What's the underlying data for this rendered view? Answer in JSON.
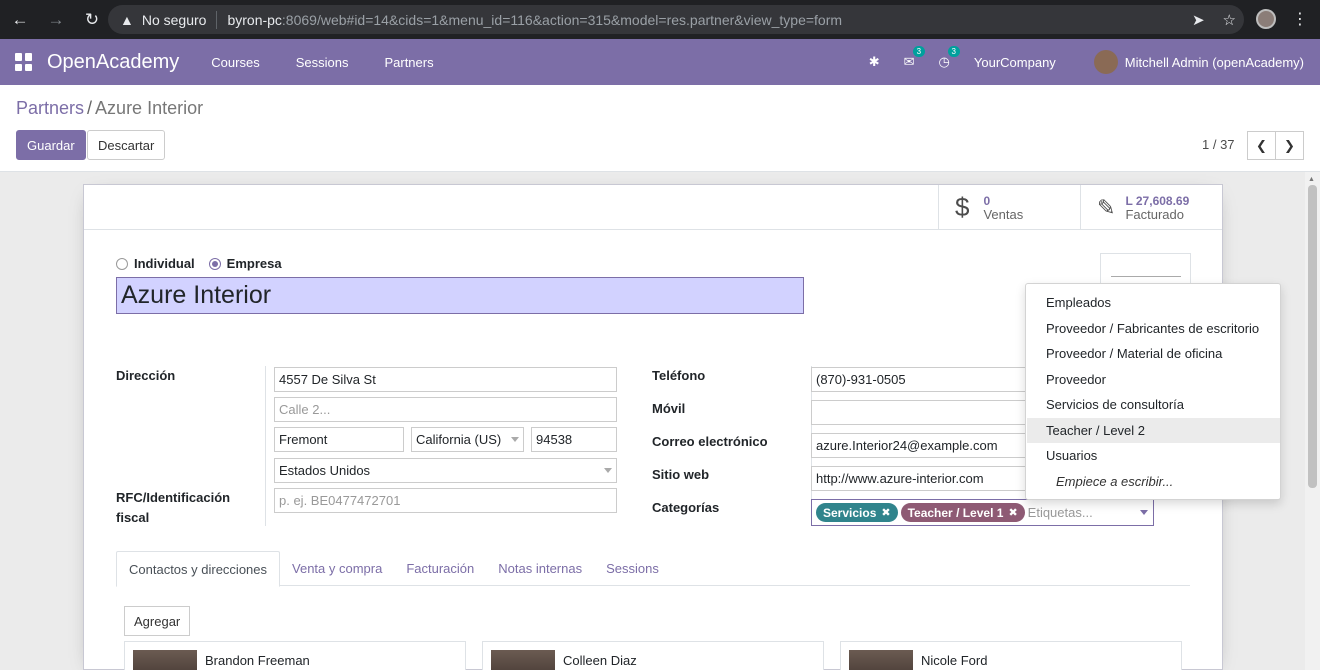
{
  "browser": {
    "insecure_label": "No seguro",
    "url_host": "byron-pc",
    "url_rest": ":8069/web#id=14&cids=1&menu_id=116&action=315&model=res.partner&view_type=form"
  },
  "navbar": {
    "brand": "OpenAcademy",
    "menu": [
      "Courses",
      "Sessions",
      "Partners"
    ],
    "messages_badge": "3",
    "activities_badge": "3",
    "company": "YourCompany",
    "user": "Mitchell Admin (openAcademy)"
  },
  "breadcrumb": {
    "parent": "Partners",
    "separator": "/",
    "current": "Azure Interior"
  },
  "buttons": {
    "save": "Guardar",
    "discard": "Descartar"
  },
  "pager": {
    "value": "1 / 37"
  },
  "smart_buttons": {
    "sales_value": "0",
    "sales_label": "Ventas",
    "invoiced_value": "L 27,608.69",
    "invoiced_label": "Facturado"
  },
  "company_type": {
    "individual": "Individual",
    "company": "Empresa",
    "selected": "Empresa"
  },
  "partner_name": "Azure Interior",
  "labels": {
    "address": "Dirección",
    "vat_line1": "RFC/Identificación",
    "vat_line2": "fiscal",
    "phone": "Teléfono",
    "mobile": "Móvil",
    "email": "Correo electrónico",
    "website": "Sitio web",
    "categories": "Categorías"
  },
  "address": {
    "street": "4557 De Silva St",
    "street2_placeholder": "Calle 2...",
    "city": "Fremont",
    "state": "California (US)",
    "zip": "94538",
    "country": "Estados Unidos",
    "vat_placeholder": "p. ej. BE0477472701"
  },
  "contact": {
    "phone": "(870)-931-0505",
    "mobile": "",
    "email": "azure.Interior24@example.com",
    "website": "http://www.azure-interior.com"
  },
  "tags": [
    {
      "label": "Servicios",
      "color": "#30848c"
    },
    {
      "label": "Teacher / Level 1",
      "color": "#8e5a74"
    }
  ],
  "tags_placeholder": "Etiquetas...",
  "dropdown": {
    "items": [
      "Empleados",
      "Proveedor / Fabricantes de escritorio",
      "Proveedor / Material de oficina",
      "Proveedor",
      "Servicios de consultoría",
      "Teacher / Level 2",
      "Usuarios"
    ],
    "highlighted": "Teacher / Level 2",
    "create_hint": "Empiece a escribir..."
  },
  "tabs": [
    "Contactos y direcciones",
    "Venta y compra",
    "Facturación",
    "Notas internas",
    "Sessions"
  ],
  "active_tab": "Contactos y direcciones",
  "add_button": "Agregar",
  "contacts": [
    "Brandon Freeman",
    "Colleen Diaz",
    "Nicole Ford"
  ],
  "colors": {
    "brand": "#7c6ea7",
    "name_bg": "#d2d2ff",
    "badge": "#00a09d"
  }
}
